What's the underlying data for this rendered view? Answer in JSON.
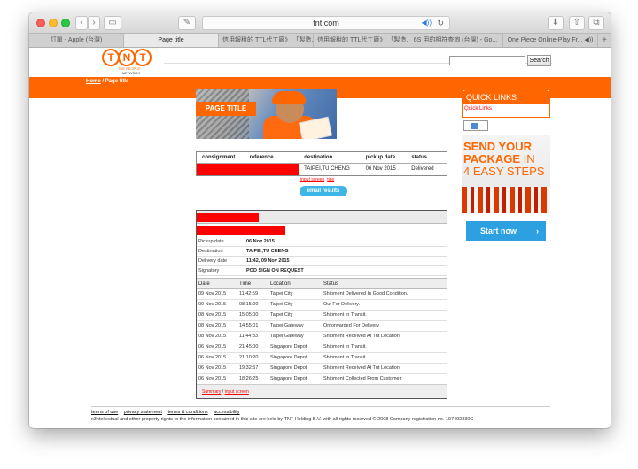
{
  "browser": {
    "url": "tnt.com",
    "tabs": [
      {
        "label": "訂單 - Apple (台灣)",
        "active": false
      },
      {
        "label": "Page title",
        "active": true
      },
      {
        "label": "信用報稅的 TTL代工廠》 「製造...",
        "active": false
      },
      {
        "label": "信用報稅的 TTL代工廠》 「製造...",
        "active": false
      },
      {
        "label": "6S 用的相符查詢 (台灣) - Go...",
        "active": false
      },
      {
        "label": "One Piece Online-Play Fr... ◀))",
        "active": false
      }
    ],
    "tab_plus": "+"
  },
  "header": {
    "logo_letters": [
      "T",
      "N",
      "T"
    ],
    "logo_tag_1": "THE PEOPLE",
    "logo_tag_2": "NETWORK",
    "search_button": "Search",
    "search_value": ""
  },
  "breadcrumb": {
    "home": "Home",
    "separator": " / ",
    "current": "Page title"
  },
  "banner": {
    "title": "PAGE TITLE"
  },
  "results": {
    "headers": [
      "consignment",
      "reference",
      "destination",
      "pickup date",
      "status"
    ],
    "row": {
      "destination": "TAIPEI,TU CHENG",
      "pickup_date": "06 Nov 2015",
      "status": "Delivered"
    },
    "link_input_screen": "input screen",
    "link_tips": "tips",
    "email_button": "email results"
  },
  "detail": {
    "info": [
      {
        "label": "Pickup date",
        "value": "06 Nov 2015"
      },
      {
        "label": "Destination",
        "value": "TAIPEI,TU CHENG"
      },
      {
        "label": "Delivery date",
        "value": "11:42, 09 Nov 2015"
      },
      {
        "label": "Signatory",
        "value": "POD SIGN ON REQUEST"
      }
    ],
    "event_headers": [
      "Date",
      "Time",
      "Location",
      "Status"
    ],
    "events": [
      {
        "date": "09 Nov 2015",
        "time": "11:42:59",
        "location": "Taipei City",
        "status": "Shipment Delivered In Good Condition."
      },
      {
        "date": "09 Nov 2015",
        "time": "08:15:00",
        "location": "Taipei City",
        "status": "Out For Delivery."
      },
      {
        "date": "08 Nov 2015",
        "time": "15:05:00",
        "location": "Taipei City",
        "status": "Shipment In Transit."
      },
      {
        "date": "08 Nov 2015",
        "time": "14:55:01",
        "location": "Taipei Gateway",
        "status": "Onforwarded For Delivery"
      },
      {
        "date": "08 Nov 2015",
        "time": "11:44:33",
        "location": "Taipei Gateway",
        "status": "Shipment Received At Tnt Location"
      },
      {
        "date": "06 Nov 2015",
        "time": "21:45:00",
        "location": "Singapore Depot",
        "status": "Shipment In Transit."
      },
      {
        "date": "06 Nov 2015",
        "time": "21:10:20",
        "location": "Singapore Depot",
        "status": "Shipment In Transit."
      },
      {
        "date": "06 Nov 2015",
        "time": "19:32:57",
        "location": "Singapore Depot",
        "status": "Shipment Received At Tnt Location"
      },
      {
        "date": "06 Nov 2015",
        "time": "18:26:25",
        "location": "Singapore Depot",
        "status": "Shipment Collected From Customer"
      }
    ],
    "footer_summary": "Summary",
    "footer_sep": " / ",
    "footer_input": "input screen"
  },
  "sidebar": {
    "quick_links_title": "QUICK LINKS",
    "quick_links_link": "Quick Links",
    "ad_line1": "SEND YOUR",
    "ad_line2": "PACKAGE",
    "ad_line2_in": " IN",
    "ad_line3": "4 EASY STEPS",
    "start_button": "Start now",
    "start_arrow": "›"
  },
  "footer": {
    "links": [
      "terms of use",
      "privacy statement",
      "terms & conditions",
      "accessibility"
    ],
    "copyright": "x3ntellectual and other property rights to the information contained in this site are held by TNT Holding B.V. with all rights reserved © 2008 Company registration no. 197402330C"
  },
  "colors": {
    "brand": "#ff6600",
    "link": "#ff0000",
    "button": "#2ca0e0"
  }
}
